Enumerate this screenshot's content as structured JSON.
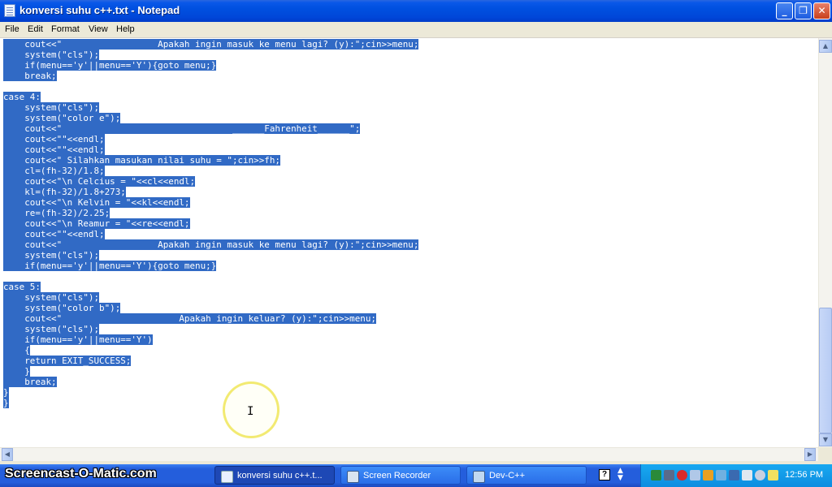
{
  "window": {
    "title": "konversi suhu c++.txt - Notepad"
  },
  "menu": [
    "File",
    "Edit",
    "Format",
    "View",
    "Help"
  ],
  "code_lines": [
    {
      "t": "    cout<<\"                  Apakah ingin masuk ke menu lagi? (y):\";cin>>menu;",
      "s": true
    },
    {
      "t": "    system(\"cls\");",
      "s": true
    },
    {
      "t": "    if(menu=='y'||menu=='Y'){goto menu;}",
      "s": true
    },
    {
      "t": "    break;",
      "s": true
    },
    {
      "t": "",
      "s": false
    },
    {
      "t": "case 4:",
      "s": true
    },
    {
      "t": "    system(\"cls\");",
      "s": true
    },
    {
      "t": "    system(\"color e\");",
      "s": true
    },
    {
      "t": "    cout<<\"                                ______Fahrenheit______\";",
      "s": true
    },
    {
      "t": "    cout<<\"\"<<endl;",
      "s": true
    },
    {
      "t": "    cout<<\"\"<<endl;",
      "s": true
    },
    {
      "t": "    cout<<\" Silahkan masukan nilai suhu = \";cin>>fh;",
      "s": true
    },
    {
      "t": "    cl=(fh-32)/1.8;",
      "s": true
    },
    {
      "t": "    cout<<\"\\n Celcius = \"<<cl<<endl;",
      "s": true
    },
    {
      "t": "    kl=(fh-32)/1.8+273;",
      "s": true
    },
    {
      "t": "    cout<<\"\\n Kelvin = \"<<kl<<endl;",
      "s": true
    },
    {
      "t": "    re=(fh-32)/2.25;",
      "s": true
    },
    {
      "t": "    cout<<\"\\n Reamur = \"<<re<<endl;",
      "s": true
    },
    {
      "t": "    cout<<\"\"<<endl;",
      "s": true
    },
    {
      "t": "    cout<<\"                  Apakah ingin masuk ke menu lagi? (y):\";cin>>menu;",
      "s": true
    },
    {
      "t": "    system(\"cls\");",
      "s": true
    },
    {
      "t": "    if(menu=='y'||menu=='Y'){goto menu;}",
      "s": true
    },
    {
      "t": "",
      "s": false
    },
    {
      "t": "case 5:",
      "s": true
    },
    {
      "t": "    system(\"cls\");",
      "s": true
    },
    {
      "t": "    system(\"color b\");",
      "s": true
    },
    {
      "t": "    cout<<\"                      Apakah ingin keluar? (y):\";cin>>menu;",
      "s": true
    },
    {
      "t": "    system(\"cls\");",
      "s": true
    },
    {
      "t": "    if(menu=='y'||menu=='Y')",
      "s": true
    },
    {
      "t": "    {",
      "s": true
    },
    {
      "t": "    return EXIT_SUCCESS;",
      "s": true
    },
    {
      "t": "    }",
      "s": true
    },
    {
      "t": "    break;",
      "s": true
    },
    {
      "t": "}",
      "s": true
    },
    {
      "t": "}",
      "s": true
    }
  ],
  "taskbar": {
    "watermark": "Screencast-O-Matic.com",
    "tasks": [
      "konversi suhu c++.t...",
      "Screen Recorder",
      "Dev-C++"
    ],
    "clock": "12:56 PM"
  },
  "colors": {
    "selection": "#316ac5",
    "titlebar": "#0054e3",
    "taskbar": "#245edc"
  }
}
